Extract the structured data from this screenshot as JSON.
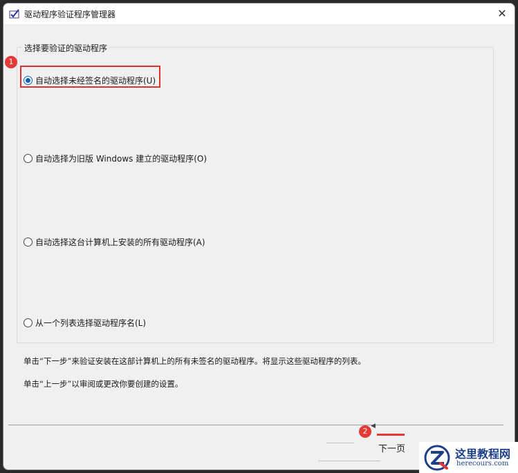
{
  "window": {
    "title": "驱动程序验证程序管理器",
    "close_glyph": "✕"
  },
  "group": {
    "legend": "选择要验证的驱动程序",
    "options": [
      {
        "label": "自动选择未经签名的驱动程序(U)",
        "checked": true
      },
      {
        "label": "自动选择为旧版 Windows 建立的驱动程序(O)",
        "checked": false
      },
      {
        "label": "自动选择这台计算机上安装的所有驱动程序(A)",
        "checked": false
      },
      {
        "label": "从一个列表选择驱动程序名(L)",
        "checked": false
      }
    ]
  },
  "description": {
    "line1": "单击“下一步”来验证安装在这部计算机上的所有未签名的驱动程序。将显示这些驱动程序的列表。",
    "line2": "单击“上一步”以审阅或更改你要创建的设置。"
  },
  "annotations": {
    "badge1": "1",
    "badge2": "2",
    "highlight_color": "#e03030"
  },
  "footer": {
    "back_caret": "◀",
    "next_label": "下一页"
  },
  "watermark": {
    "title": "这里教程网",
    "url": "herecours.com"
  },
  "icons": {
    "app": "driver-verifier-icon",
    "close": "close-icon",
    "watermark_logo": "z-logo-icon"
  }
}
